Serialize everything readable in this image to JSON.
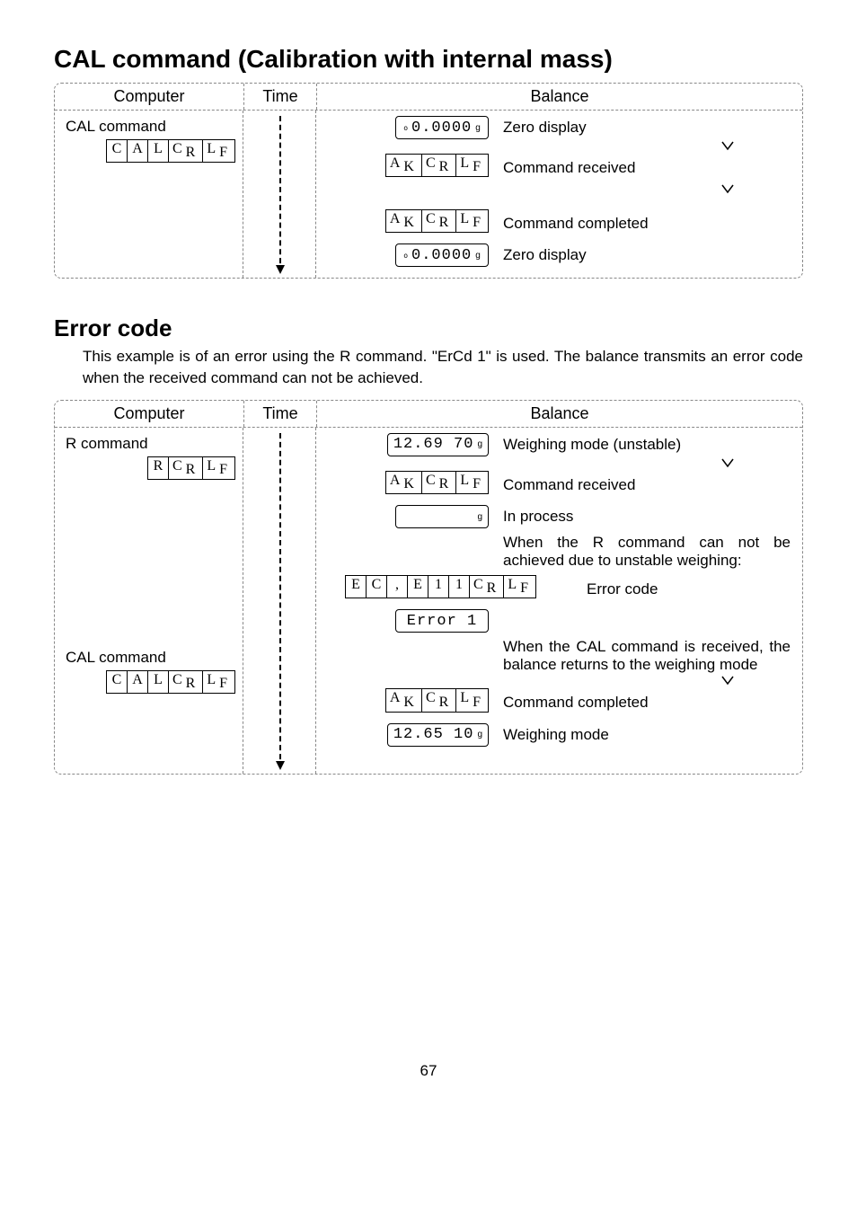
{
  "title1": "CAL command (Calibration with internal mass)",
  "title2": "Error code",
  "body1": "This example is of an error using the R command. \"ErCd 1\" is used. The balance transmits an error code when the received command can not be achieved.",
  "hdr": {
    "computer": "Computer",
    "time": "Time",
    "balance": "Balance"
  },
  "diagram1": {
    "cmd1_label": "CAL command",
    "cmd1_bytes": [
      "C",
      "A",
      "L",
      "C_R",
      "L_F"
    ],
    "rows": [
      {
        "disp_type": "lcd",
        "value": "0.0000",
        "unit": "g",
        "stable": "o",
        "desc": "Zero display"
      },
      {
        "disp_type": "ack",
        "value": [
          "A_K",
          "C_R",
          "L_F"
        ],
        "desc": "Command received"
      },
      {
        "disp_type": "ack",
        "value": [
          "A_K",
          "C_R",
          "L_F"
        ],
        "desc": "Command completed"
      },
      {
        "disp_type": "lcd",
        "value": "0.0000",
        "unit": "g",
        "stable": "o",
        "desc": "Zero display"
      }
    ]
  },
  "diagram2": {
    "cmd1_label": "R command",
    "cmd1_bytes": [
      "R",
      "C_R",
      "L_F"
    ],
    "cmd2_label": "CAL command",
    "cmd2_bytes": [
      "C",
      "A",
      "L",
      "C_R",
      "L_F"
    ],
    "rows": [
      {
        "disp_type": "lcd",
        "value": "12.69 70",
        "unit": "g",
        "desc": "Weighing mode (unstable)"
      },
      {
        "disp_type": "ack",
        "value": [
          "A_K",
          "C_R",
          "L_F"
        ],
        "desc": "Command received"
      },
      {
        "disp_type": "lcd-empty",
        "unit": "g",
        "desc": "In process"
      },
      {
        "disp_type": "none",
        "desc": "When the R command can not be achieved due to unstable weighing:"
      },
      {
        "disp_type": "err",
        "value": [
          "E",
          "C",
          ",",
          "E",
          "1",
          "1",
          "C_R",
          "L_F"
        ],
        "desc": "Error code"
      },
      {
        "disp_type": "lcd",
        "value": "Error 1",
        "desc": ""
      },
      {
        "disp_type": "none",
        "desc": "When the CAL command is received, the balance returns to the weighing mode"
      },
      {
        "disp_type": "ack",
        "value": [
          "A_K",
          "C_R",
          "L_F"
        ],
        "desc": "Command completed"
      },
      {
        "disp_type": "lcd",
        "value": "12.65 10",
        "unit": "g",
        "desc": "Weighing mode"
      }
    ]
  },
  "pagenum": "67"
}
